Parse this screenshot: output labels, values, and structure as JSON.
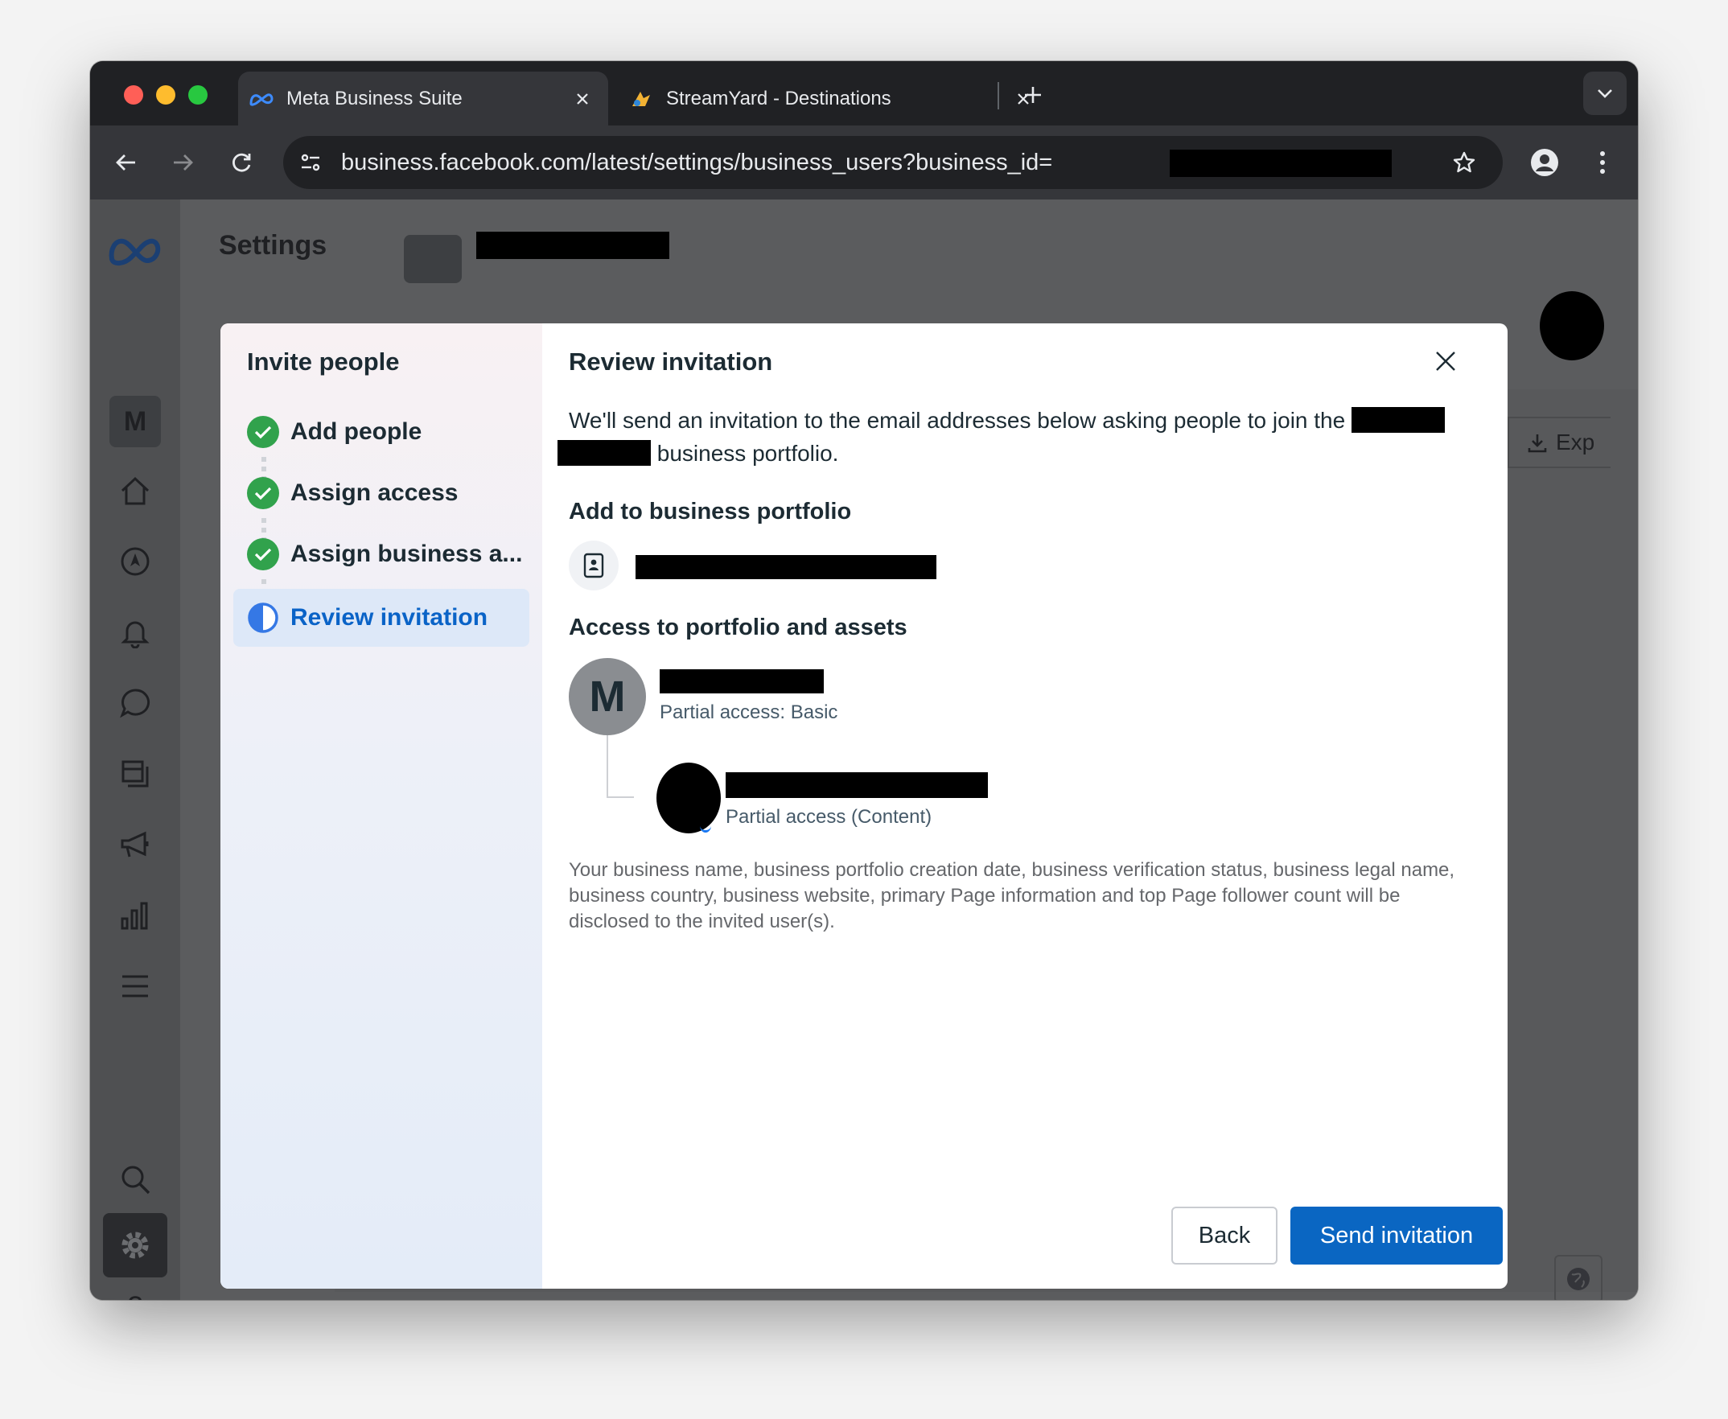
{
  "browser": {
    "tabs": [
      {
        "title": "Meta Business Suite",
        "favicon": "meta-logo-icon",
        "active": true
      },
      {
        "title": "StreamYard - Destinations",
        "favicon": "streamyard-icon",
        "active": false
      }
    ],
    "url": "business.facebook.com/latest/settings/business_users?business_id="
  },
  "background_page": {
    "settings_title": "Settings",
    "workspace_initial": "M",
    "export_label": "Exp"
  },
  "modal": {
    "sidebar": {
      "title": "Invite people",
      "steps": [
        {
          "label": "Add people",
          "status": "done"
        },
        {
          "label": "Assign access",
          "status": "done"
        },
        {
          "label": "Assign business a...",
          "status": "done"
        },
        {
          "label": "Review invitation",
          "status": "current"
        }
      ]
    },
    "content": {
      "title": "Review invitation",
      "intro_part1": "We'll send an invitation to the email addresses below asking people to join the",
      "intro_part2": "business portfolio.",
      "portfolio_heading": "Add to business portfolio",
      "access_heading": "Access to portfolio and assets",
      "portfolio_avatar_initial": "M",
      "portfolio_access": "Partial access: Basic",
      "asset_access": "Partial access (Content)",
      "disclaimer": "Your business name, business portfolio creation date, business verification status, business legal name, business country, business website, primary Page information and top Page follower count will be disclosed to the invited user(s)."
    },
    "buttons": {
      "back": "Back",
      "send": "Send invitation"
    }
  },
  "colors": {
    "primary_blue": "#0a66c2",
    "check_green": "#31a24c",
    "meta_blue": "#0668e1"
  }
}
